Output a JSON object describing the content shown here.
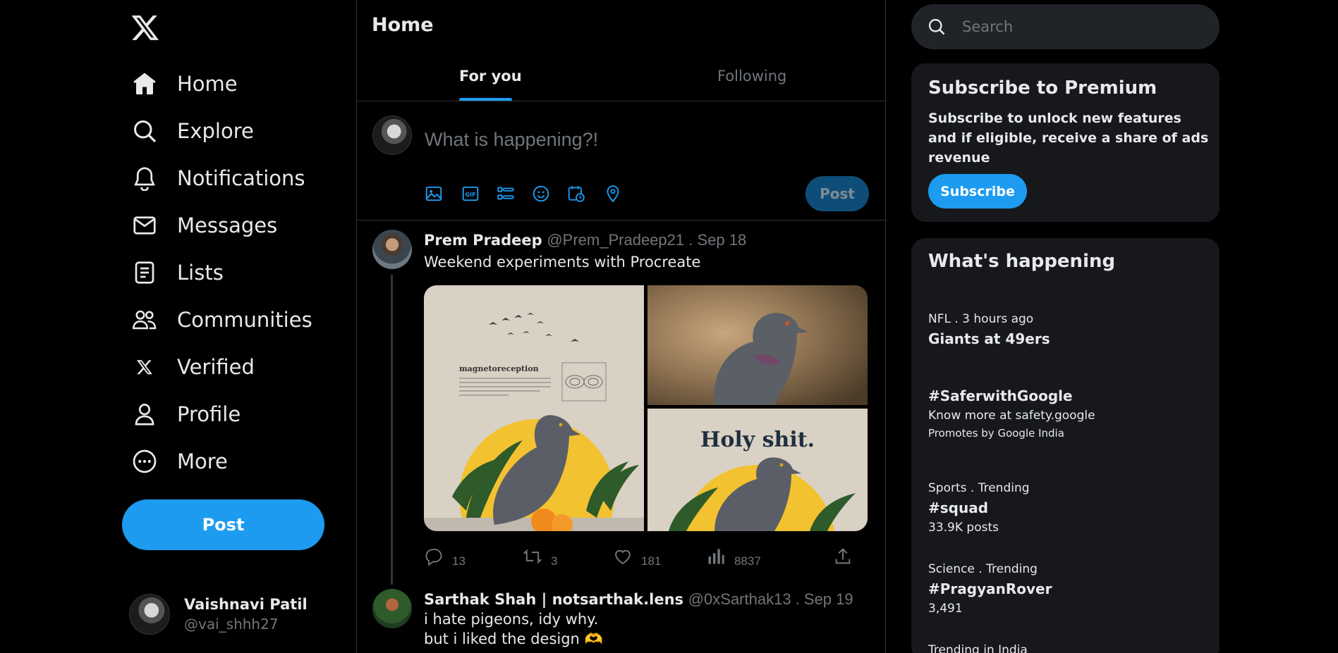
{
  "nav": {
    "logo": "x-logo-icon",
    "items": [
      {
        "label": "Home",
        "icon": "home-icon"
      },
      {
        "label": "Explore",
        "icon": "search-icon"
      },
      {
        "label": "Notifications",
        "icon": "bell-icon"
      },
      {
        "label": "Messages",
        "icon": "envelope-icon"
      },
      {
        "label": "Lists",
        "icon": "list-icon"
      },
      {
        "label": "Communities",
        "icon": "people-icon"
      },
      {
        "label": "Verified",
        "icon": "x-logo-icon"
      },
      {
        "label": "Profile",
        "icon": "person-icon"
      },
      {
        "label": "More",
        "icon": "more-circle-icon"
      }
    ],
    "post_label": "Post"
  },
  "account": {
    "name": "Vaishnavi Patil",
    "handle": "@vai_shhh27"
  },
  "main": {
    "title": "Home",
    "tabs": [
      {
        "label": "For you",
        "active": true
      },
      {
        "label": "Following",
        "active": false
      }
    ],
    "composer": {
      "placeholder": "What is happening?!",
      "post_label": "Post",
      "tools": [
        "image-icon",
        "gif-icon",
        "poll-icon",
        "emoji-icon",
        "schedule-icon",
        "location-icon"
      ]
    },
    "tweets": [
      {
        "name": "Prem Pradeep",
        "handle": "@Prem_Pradeep21 . Sep 18",
        "lines": [
          "Weekend experiments with Procreate"
        ],
        "media_text": {
          "image1_heading": "magnetoreception",
          "image3_heading": "Holy shit."
        },
        "stats": {
          "replies": "13",
          "retweets": "3",
          "likes": "181",
          "views": "8837"
        }
      },
      {
        "name": "Sarthak Shah | notsarthak.lens",
        "handle": "@0xSarthak13 . Sep 19",
        "lines": [
          "i hate pigeons, idy why.",
          "but i liked the design 🫶"
        ]
      }
    ]
  },
  "search": {
    "placeholder": "Search"
  },
  "premium": {
    "title": "Subscribe to Premium",
    "description": "Subscribe to unlock new features and if eligible, receive a share of ads revenue",
    "button": "Subscribe"
  },
  "trends": {
    "title": "What's happening",
    "items": [
      {
        "meta": "NFL . 3 hours ago",
        "name": "Giants at 49ers"
      },
      {
        "name": "#SaferwithGoogle",
        "sub": "Know more at safety.google",
        "sub2": "Promotes by Google India"
      },
      {
        "meta": "Sports . Trending",
        "name": "#squad",
        "sub": "33.9K posts"
      },
      {
        "meta": "Science . Trending",
        "name": "#PragyanRover",
        "sub": "3,491"
      },
      {
        "meta": "Trending in India"
      }
    ]
  },
  "colors": {
    "accent": "#1d9bf0",
    "background": "#000000",
    "card": "#16181c",
    "muted": "#71767b"
  }
}
